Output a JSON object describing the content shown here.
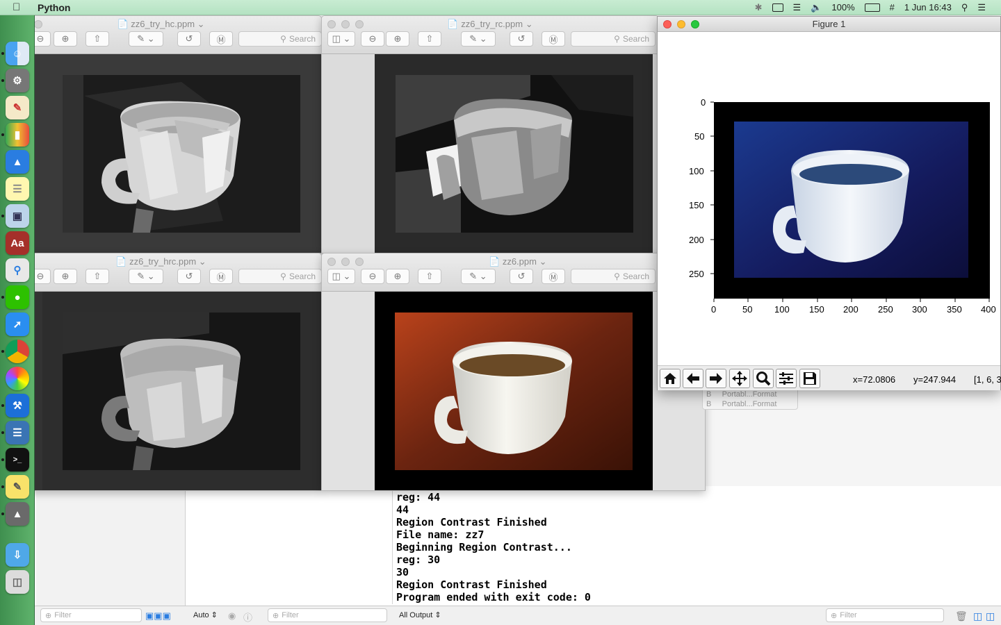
{
  "menubar": {
    "app_name": "Python",
    "battery": "100%",
    "date_time": "1 Jun  16:43"
  },
  "dock": {
    "items": [
      "Finder",
      "System Preferences",
      "TextEdit",
      "Numbers",
      "Keynote",
      "Notes",
      "Preview",
      "Dictionary",
      "Spotlight Tool",
      "WeChat",
      "Safari",
      "Chrome",
      "Photos",
      "Xcode",
      "Python Launcher",
      "Terminal",
      "Stickies",
      "Rocket",
      "Downloads",
      "Trash"
    ]
  },
  "preview_windows": [
    {
      "title": "zz6_try_hc.ppm",
      "search": "Search",
      "image": "grayscale posterized cup (histogram contrast)"
    },
    {
      "title": "zz6_try_rc.ppm",
      "search": "Search",
      "image": "grayscale posterized cup (region contrast)"
    },
    {
      "title": "zz6_try_hrc.ppm",
      "search": "Search",
      "image": "grayscale posterized cup (combined contrast)"
    },
    {
      "title": "zz6.ppm",
      "search": "Search",
      "image": "white cup of tea on brown background"
    }
  ],
  "figure": {
    "title": "Figure 1",
    "y_ticks": [
      "0",
      "50",
      "100",
      "150",
      "200",
      "250"
    ],
    "x_ticks": [
      "0",
      "50",
      "100",
      "150",
      "200",
      "250",
      "300",
      "350",
      "400"
    ],
    "status_x": "x=72.0806",
    "status_y": "y=247.944",
    "status_val": "[1, 6, 3",
    "tools": [
      "home-icon",
      "back-arrow-icon",
      "forward-arrow-icon",
      "pan-icon",
      "zoom-icon",
      "configure-icon",
      "save-icon"
    ]
  },
  "popup": {
    "rows": [
      {
        "prefix": "B",
        "label": "Portabl...Format"
      },
      {
        "prefix": "B",
        "label": "Portabl...Format"
      }
    ]
  },
  "console": {
    "lines": [
      "reg: 44",
      "44",
      "Region Contrast Finished",
      "File name: zz7",
      "Beginning Region Contrast...",
      "reg: 30",
      "30",
      "Region Contrast Finished",
      "Program ended with exit code: 0"
    ]
  },
  "bottom_bar": {
    "filter_left": "Filter",
    "auto_label": "Auto ⇕",
    "filter_mid": "Filter",
    "output_label": "All Output ⇕",
    "filter_right": "Filter"
  },
  "colors": {
    "menubar": "#c8ecd2",
    "dock": "#4f9f5c",
    "plot_blue": "#1a237e",
    "tea_brown": "#6b2410"
  }
}
